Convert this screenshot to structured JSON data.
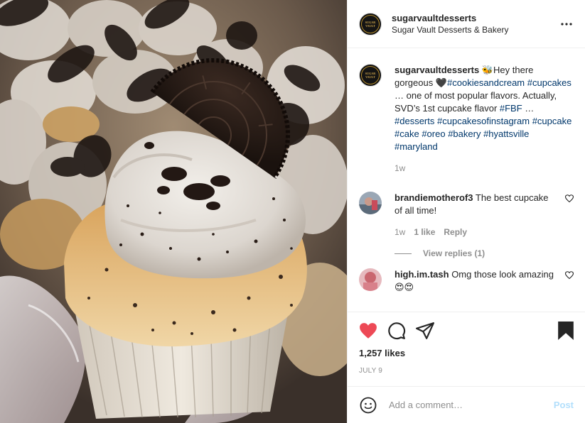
{
  "post": {
    "username": "sugarvaultdesserts",
    "location": "Sugar Vault Desserts & Bakery",
    "avatar_text": "SUGAR VAULT",
    "caption": {
      "username": "sugarvaultdesserts",
      "emoji": "🐝",
      "text_1": "Hey there gorgeous 🖤",
      "tag_1": "#cookiesandcream",
      "tag_2": "#cupcakes",
      "text_2": " … one of most popular flavors. Actually, SVD’s 1st cupcake flavor ",
      "tag_3": "#FBF",
      "text_3": " … ",
      "tag_4": "#desserts",
      "tag_5": "#cupcakesofinstagram",
      "tag_6": "#cupcake",
      "tag_7": "#cake",
      "tag_8": "#oreo",
      "tag_9": "#bakery",
      "tag_10": "#hyattsville",
      "tag_11": "#maryland",
      "age": "1w"
    },
    "comments": [
      {
        "username": "brandiemotherof3",
        "text": "The best cupcake of all time!",
        "age": "1w",
        "likes": "1 like",
        "reply": "Reply",
        "view_replies": "View replies (1)"
      },
      {
        "username": "high.im.tash",
        "text": "Omg those look amazing 😍😍"
      }
    ],
    "likes": "1,257 likes",
    "date": "JULY 9",
    "add_comment_placeholder": "Add a comment…",
    "post_button": "Post"
  },
  "colors": {
    "heart": "#ed4956",
    "hashtag": "#00376b",
    "post_button": "#b2dffc",
    "muted": "#8e8e8e"
  },
  "icons": [
    "more-icon",
    "heart-icon",
    "comment-icon",
    "share-icon",
    "bookmark-icon",
    "emoji-icon",
    "small-heart-icon"
  ]
}
